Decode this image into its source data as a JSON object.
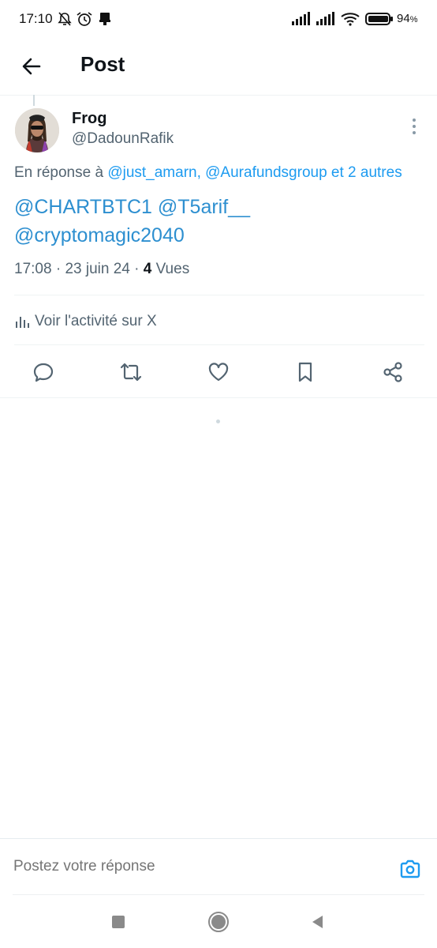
{
  "status_bar": {
    "time": "17:10",
    "battery_percent": "94",
    "battery_unit": "%",
    "icons": [
      "mute-notifications-icon",
      "alarm-icon",
      "usb-debug-icon",
      "signal-icon",
      "signal-icon",
      "wifi-icon",
      "battery-icon"
    ]
  },
  "header": {
    "title": "Post",
    "back_icon": "arrow-left-icon"
  },
  "post": {
    "author_name": "Frog",
    "author_handle": "@DadounRafik",
    "reply_prefix": "En réponse à ",
    "reply_mentions": "@just_amarn, @Aurafundsgroup et 2 autres",
    "text_line1": "@CHARTBTC1 @T5arif__",
    "text_line2": "@cryptomagic2040",
    "time": "17:08",
    "date": "23 juin 24",
    "views_count": "4",
    "views_label": "Vues",
    "activity_label": "Voir l'activité sur X"
  },
  "actions": [
    "reply-icon",
    "repost-icon",
    "like-icon",
    "bookmark-icon",
    "share-icon"
  ],
  "composer": {
    "placeholder": "Postez votre réponse"
  },
  "colors": {
    "accent": "#1d9bf0",
    "text_primary": "#0f1419",
    "text_secondary": "#536471"
  }
}
